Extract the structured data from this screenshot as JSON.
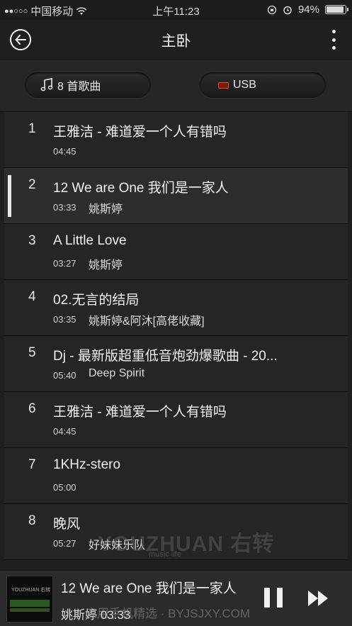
{
  "status_bar": {
    "carrier": "中国移动",
    "time": "上午11:23",
    "battery": "94%",
    "battery_level": 0.94
  },
  "header": {
    "title": "主卧"
  },
  "filters": {
    "songs_label": "8 首歌曲",
    "source_label": "USB"
  },
  "songs": [
    {
      "index": "1",
      "title": "王雅洁 - 难道爱一个人有错吗",
      "duration": "04:45",
      "artist": ""
    },
    {
      "index": "2",
      "title": "12 We are One 我们是一家人",
      "duration": "03:33",
      "artist": "姚斯婷"
    },
    {
      "index": "3",
      "title": "A Little Love",
      "duration": "03:27",
      "artist": "姚斯婷"
    },
    {
      "index": "4",
      "title": "02.无言的结局",
      "duration": "03:35",
      "artist": "姚斯婷&阿沐[高佬收藏]"
    },
    {
      "index": "5",
      "title": "Dj - 最新版超重低音炮劲爆歌曲 - 20...",
      "duration": "05:40",
      "artist": "Deep Spirit"
    },
    {
      "index": "6",
      "title": "王雅洁 - 难道爱一个人有错吗",
      "duration": "04:45",
      "artist": ""
    },
    {
      "index": "7",
      "title": "1KHz-stero",
      "duration": "05:00",
      "artist": ""
    },
    {
      "index": "8",
      "title": "晚风",
      "duration": "05:27",
      "artist": "好妹妹乐队"
    }
  ],
  "active_song_index": 1,
  "watermark": {
    "logo": "YOUZHUAN 右转",
    "tagline": "music life",
    "site": "应用手机精选 · BYJSJXY.COM"
  },
  "now_playing": {
    "title": "12 We are One 我们是一家人",
    "artist": "姚斯婷",
    "time": "03:33",
    "album_brand": "YOUZHUAN 右转"
  },
  "colors": {
    "background": "#1f1f1f",
    "row": "#252525",
    "row_active": "#2d2d2d",
    "text": "#f2f2f2"
  }
}
